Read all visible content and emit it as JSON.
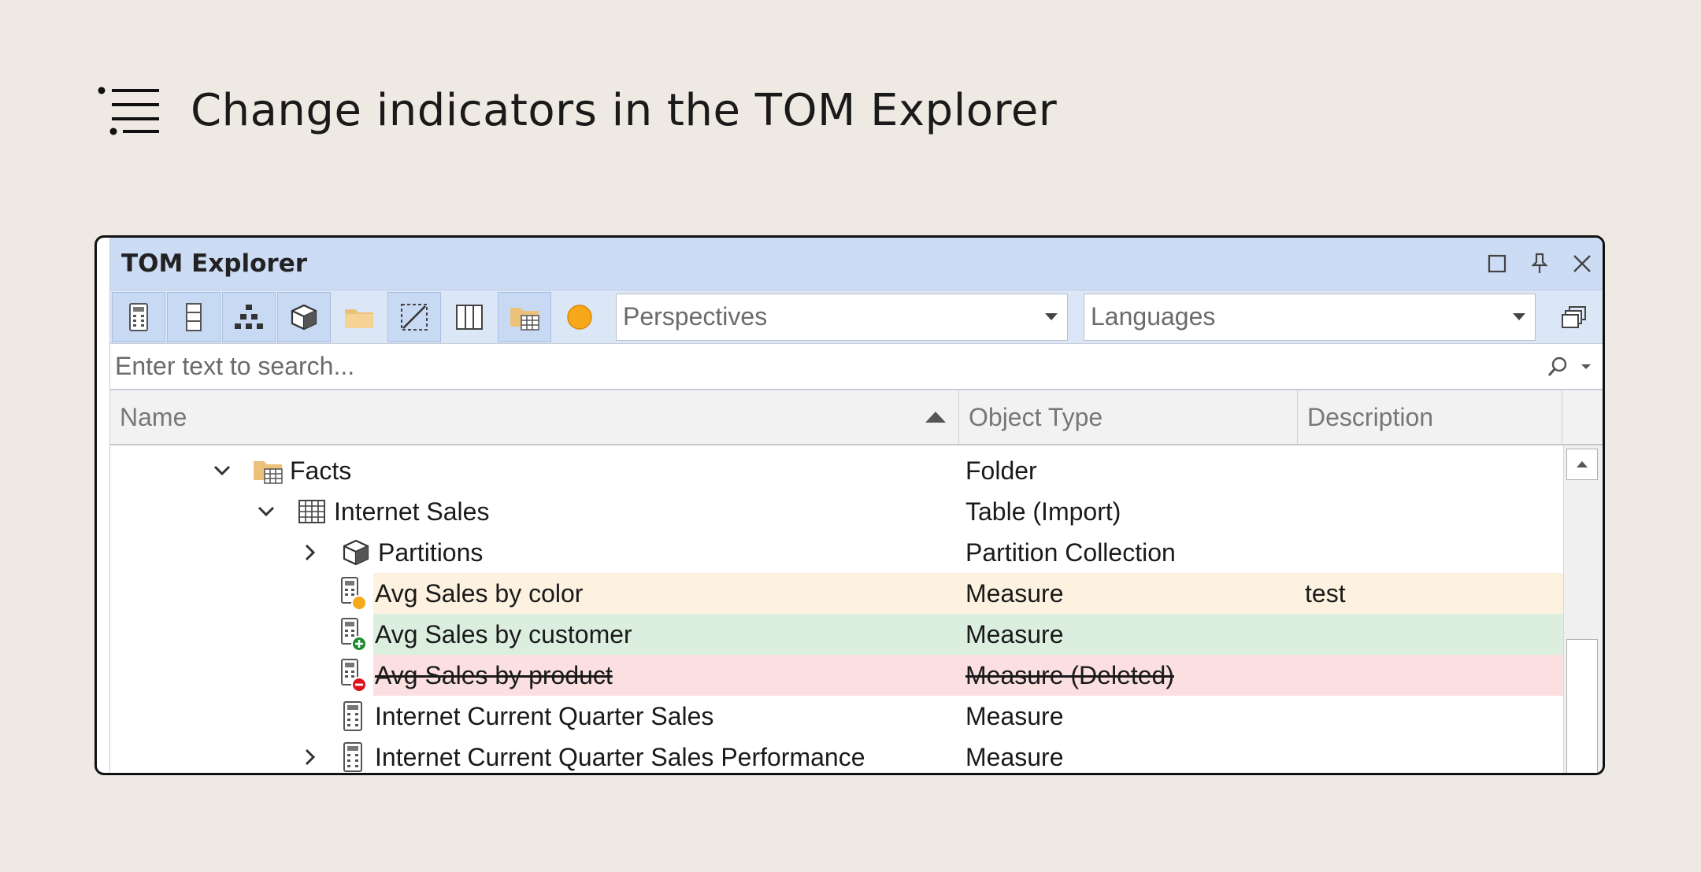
{
  "heading": {
    "title": "Change indicators in the TOM Explorer"
  },
  "window": {
    "title": "TOM Explorer",
    "perspectives_placeholder": "Perspectives",
    "languages_placeholder": "Languages",
    "search_placeholder": "Enter text to search..."
  },
  "columns": {
    "name": "Name",
    "object_type": "Object Type",
    "description": "Description"
  },
  "rows": [
    {
      "name": "Facts",
      "type": "Folder",
      "description": ""
    },
    {
      "name": "Internet Sales",
      "type": "Table (Import)",
      "description": ""
    },
    {
      "name": "Partitions",
      "type": "Partition Collection",
      "description": ""
    },
    {
      "name": "Avg Sales by color",
      "type": "Measure",
      "description": "test",
      "status": "modified"
    },
    {
      "name": "Avg Sales by customer",
      "type": "Measure",
      "description": "",
      "status": "added"
    },
    {
      "name": "Avg Sales by product",
      "type": "Measure (Deleted)",
      "description": "",
      "status": "deleted"
    },
    {
      "name": "Internet Current Quarter Sales",
      "type": "Measure",
      "description": ""
    },
    {
      "name": "Internet Current Quarter Sales Performance",
      "type": "Measure",
      "description": ""
    }
  ],
  "colors": {
    "modified_row": "#fdf1df",
    "added_row": "#dcefdf",
    "deleted_row": "#fbdfe1",
    "modified_dot": "#f6a81a",
    "added_dot": "#1e8a2e",
    "deleted_dot": "#e0101e"
  }
}
